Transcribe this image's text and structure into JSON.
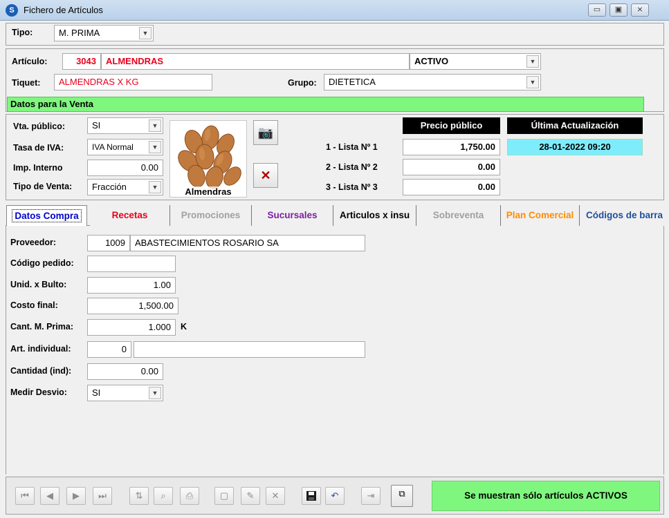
{
  "window": {
    "title": "Fichero de Artículos",
    "controls": {
      "minimize": "▭",
      "maximize": "▣",
      "close": "⨯"
    }
  },
  "tipo": {
    "label": "Tipo:",
    "value": "M. PRIMA"
  },
  "articulo": {
    "label": "Artículo:",
    "code": "3043",
    "name": "ALMENDRAS",
    "status": "ACTIVO"
  },
  "tiquet": {
    "label": "Tiquet:",
    "value": "ALMENDRAS X KG"
  },
  "grupo": {
    "label": "Grupo:",
    "value": "DIETETICA"
  },
  "venta_header": "Datos para la Venta",
  "venta": {
    "vta_publico": {
      "label": "Vta. público:",
      "value": "SI"
    },
    "tasa_iva": {
      "label": "Tasa de IVA:",
      "value": "IVA Normal"
    },
    "imp_interno": {
      "label": "Imp. Interno",
      "value": "0.00"
    },
    "tipo_venta": {
      "label": "Tipo de Venta:",
      "value": "Fracción"
    }
  },
  "image": {
    "caption": "Almendras"
  },
  "precios": {
    "header": "Precio público",
    "ultima_header": "Última Actualización",
    "ultima_value": "28-01-2022 09:20",
    "listas": [
      {
        "label": "1 - Lista Nº 1",
        "value": "1,750.00"
      },
      {
        "label": "2 - Lista Nº 2",
        "value": "0.00"
      },
      {
        "label": "3 - Lista Nº 3",
        "value": "0.00"
      }
    ]
  },
  "tabs": [
    {
      "label": "Datos Compra",
      "color": "#0000cc"
    },
    {
      "label": "Recetas",
      "color": "#e8001c"
    },
    {
      "label": "Promociones",
      "color": "#a0a0a0"
    },
    {
      "label": "Sucursales",
      "color": "#7b1fa2"
    },
    {
      "label": "Articulos x insu",
      "color": "#000000"
    },
    {
      "label": "Sobreventa",
      "color": "#a0a0a0"
    },
    {
      "label": "Plan Comercial",
      "color": "#ff8c00"
    },
    {
      "label": "Códigos de barra",
      "color": "#1f4e9c"
    }
  ],
  "compra": {
    "proveedor": {
      "label": "Proveedor:",
      "code": "1009",
      "name": "ABASTECIMIENTOS ROSARIO SA"
    },
    "codigo_pedido": {
      "label": "Código pedido:",
      "value": ""
    },
    "unid_bulto": {
      "label": "Unid. x Bulto:",
      "value": "1.00"
    },
    "costo_final": {
      "label": "Costo final:",
      "value": "1,500.00"
    },
    "cant_mprima": {
      "label": "Cant. M. Prima:",
      "value": "1.000",
      "unit": "K"
    },
    "art_individual": {
      "label": "Art. individual:",
      "value": "0",
      "desc": ""
    },
    "cantidad_ind": {
      "label": "Cantidad (ind):",
      "value": "0.00"
    },
    "medir_desvio": {
      "label": "Medir Desvio:",
      "value": "SI"
    }
  },
  "toolbar": {
    "first": "⏮",
    "prev": "◀",
    "next": "▶",
    "last": "⏭",
    "sort": "⇅",
    "find": "⌕",
    "print": "⎙",
    "new": "▢",
    "edit": "✎",
    "delete": "✕",
    "save": "💾",
    "undo": "↶",
    "exit": "⇥",
    "copy": "⧉",
    "status_button": "Se muestran sólo artículos ACTIVOS"
  }
}
